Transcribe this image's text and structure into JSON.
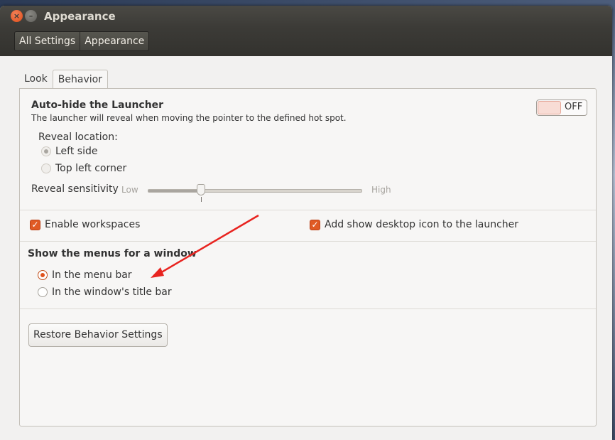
{
  "window": {
    "title": "Appearance",
    "close_glyph": "×",
    "minimize_glyph": "–"
  },
  "breadcrumbs": [
    "All Settings",
    "Appearance"
  ],
  "tabs": [
    {
      "label": "Look",
      "active": false
    },
    {
      "label": "Behavior",
      "active": true
    }
  ],
  "launcher": {
    "title": "Auto-hide the Launcher",
    "description": "The launcher will reveal when moving the pointer to the defined hot spot.",
    "toggle_label": "OFF",
    "toggle_on": false,
    "reveal_location_label": "Reveal location:",
    "reveal_options": [
      {
        "label": "Left side",
        "selected": true
      },
      {
        "label": "Top left corner",
        "selected": false
      }
    ],
    "sensitivity_label": "Reveal sensitivity",
    "sensitivity_low": "Low",
    "sensitivity_high": "High",
    "sensitivity_value": 0.25
  },
  "workspaces": {
    "enable_label": "Enable workspaces",
    "enable_checked": true,
    "show_desktop_label": "Add show desktop icon to the launcher",
    "show_desktop_checked": true
  },
  "menus": {
    "title": "Show the menus for a window",
    "options": [
      {
        "label": "In the menu bar",
        "selected": true
      },
      {
        "label": "In the window's title bar",
        "selected": false
      }
    ]
  },
  "restore_button": "Restore Behavior Settings",
  "colors": {
    "accent": "#e0521c",
    "annotation_arrow": "#e8231f"
  },
  "icons": {
    "check": "✓"
  }
}
